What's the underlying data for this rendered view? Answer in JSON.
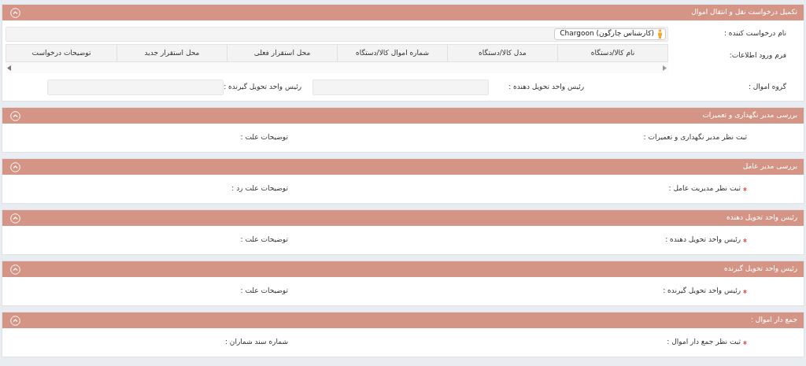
{
  "request": {
    "title": "تکمیل درخواست نقل و انتقال اموال",
    "expanded": true,
    "requester_label": "نام درخواست کننده :",
    "requester": "Chargoon (کارشناس چارگون)",
    "form_label": "فرم ورود اطلاعات:",
    "columns": [
      "نام کالا/دستگاه",
      "مدل کالا/دستگاه",
      "شماره اموال کالا/دستگاه",
      "محل استقرار فعلی",
      "محل استقرار جدید",
      "توضیحات درخواست"
    ],
    "group_label": "گروه اموال :",
    "giver_label": "رئیس واحد تحویل دهنده :",
    "receiver_label": "رئیس واحد تحویل گیرنده :"
  },
  "sections": [
    {
      "title": "بررسی مدیر نگهداری و تعمیرات",
      "expanded": true,
      "fields": [
        {
          "label": "ثبت نظر مدیر نگهداری و تعمیرات :",
          "required": false
        },
        {
          "label": "توضیحات علت :",
          "required": false
        }
      ]
    },
    {
      "title": "بررسی مدیر عامل",
      "expanded": true,
      "fields": [
        {
          "label": "ثبت نظر مدیریت عامل :",
          "required": true
        },
        {
          "label": "توضیحات علت رد :",
          "required": false
        }
      ]
    },
    {
      "title": "رئیس واحد تحویل دهنده",
      "expanded": true,
      "fields": [
        {
          "label": "رئیس واحد تحویل دهنده :",
          "required": true
        },
        {
          "label": "توضیحات علت :",
          "required": false
        }
      ]
    },
    {
      "title": "رئیس واحد تحویل گیرنده",
      "expanded": true,
      "fields": [
        {
          "label": "رئیس واحد تحویل گیرنده :",
          "required": true
        },
        {
          "label": "توضیحات علت :",
          "required": false
        }
      ]
    },
    {
      "title": "جمع دار اموال :",
      "expanded": true,
      "fields": [
        {
          "label": "ثبت نظر جمع دار اموال :",
          "required": true
        },
        {
          "label": "شماره سند شماران :",
          "required": false
        }
      ]
    }
  ]
}
